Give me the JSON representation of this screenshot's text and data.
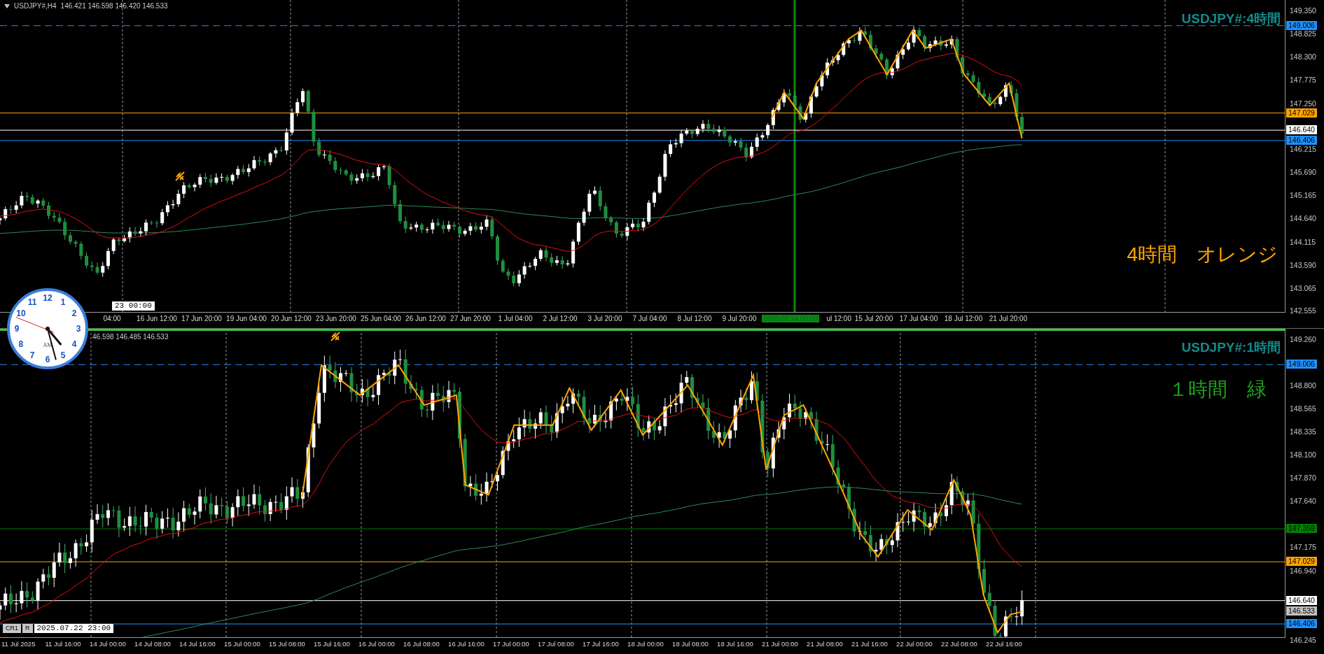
{
  "panes": [
    {
      "header": {
        "symbol": "USDJPY#,H4",
        "ohlc": "146.421 146.598 146.420 146.533"
      },
      "title": "USDJPY#:4時間",
      "note": "4時間　オレンジ",
      "price_ticks": [
        "149.350",
        "148.825",
        "148.300",
        "147.775",
        "147.250",
        "146.215",
        "145.690",
        "145.165",
        "144.640",
        "144.115",
        "143.590",
        "143.065",
        "142.555"
      ],
      "price_markers": [
        {
          "label": "149.006",
          "color": "#1e90ff",
          "kind": "dashed"
        },
        {
          "label": "147.029",
          "color": "#ffa500",
          "kind": "solid"
        },
        {
          "label": "146.640",
          "color": "#ffffff",
          "kind": "solid"
        },
        {
          "label": "146.406",
          "color": "#1e90ff",
          "kind": "solid"
        }
      ],
      "cursor_label": "23 00:00",
      "time_labels": [
        {
          "label": "04:00",
          "kind": "tick"
        },
        {
          "label": "16 Jun 12:00",
          "kind": "tick"
        },
        {
          "label": "17 Jun 20:00",
          "kind": "tick"
        },
        {
          "label": "19 Jun 04:00",
          "kind": "tick"
        },
        {
          "label": "20 Jun 12:00",
          "kind": "tick"
        },
        {
          "label": "23 Jun 20:00",
          "kind": "tick"
        },
        {
          "label": "25 Jun 04:00",
          "kind": "tick"
        },
        {
          "label": "26 Jun 12:00",
          "kind": "tick"
        },
        {
          "label": "27 Jun 20:00",
          "kind": "tick"
        },
        {
          "label": "1 Jul 04:00",
          "kind": "tick"
        },
        {
          "label": "2 Jul 12:00",
          "kind": "tick"
        },
        {
          "label": "3 Jul 20:00",
          "kind": "tick"
        },
        {
          "label": "7 Jul 04:00",
          "kind": "tick"
        },
        {
          "label": "8 Jul 12:00",
          "kind": "tick"
        },
        {
          "label": "9 Jul 20:00",
          "kind": "tick"
        },
        {
          "label": "2025.07.14 00:00",
          "kind": "cursor"
        },
        {
          "label": "ul 12:00",
          "kind": "tick"
        },
        {
          "label": "15 Jul 20:00",
          "kind": "tick"
        },
        {
          "label": "17 Jul 04:00",
          "kind": "tick"
        },
        {
          "label": "18 Jul 12:00",
          "kind": "tick"
        },
        {
          "label": "21 Jul 20:00",
          "kind": "tick"
        }
      ]
    },
    {
      "header": {
        "ohlc": "46.598 146.485 146.533"
      },
      "title": "USDJPY#:1時間",
      "note": "１時間　緑",
      "price_ticks": [
        "149.260",
        "148.800",
        "148.565",
        "148.335",
        "148.100",
        "147.870",
        "147.640",
        "147.175",
        "146.940",
        "146.245"
      ],
      "price_markers": [
        {
          "label": "149.006",
          "color": "#1e90ff",
          "kind": "dashed"
        },
        {
          "label": "147.359",
          "color": "#008000",
          "kind": "solid"
        },
        {
          "label": "147.029",
          "color": "#ffa500",
          "kind": "solid"
        },
        {
          "label": "146.640",
          "color": "#ffffff",
          "kind": "solid"
        },
        {
          "label": "146.533",
          "color": "#c0c0c0",
          "kind": "none"
        },
        {
          "label": "146.406",
          "color": "#1e90ff",
          "kind": "solid"
        }
      ],
      "status_tags": [
        "CR1",
        "R"
      ],
      "cursor_label": "2025.07.22 23:00",
      "time_labels": [
        {
          "label": "11 Jul 2025",
          "kind": "tick"
        },
        {
          "label": "11 Jul 16:00",
          "kind": "tick"
        },
        {
          "label": "14 Jul 00:00",
          "kind": "tick"
        },
        {
          "label": "14 Jul 08:00",
          "kind": "tick"
        },
        {
          "label": "14 Jul 16:00",
          "kind": "tick"
        },
        {
          "label": "15 Jul 00:00",
          "kind": "tick"
        },
        {
          "label": "15 Jul 08:00",
          "kind": "tick"
        },
        {
          "label": "15 Jul 16:00",
          "kind": "tick"
        },
        {
          "label": "16 Jul 00:00",
          "kind": "tick"
        },
        {
          "label": "16 Jul 08:00",
          "kind": "tick"
        },
        {
          "label": "16 Jul 16:00",
          "kind": "tick"
        },
        {
          "label": "17 Jul 00:00",
          "kind": "tick"
        },
        {
          "label": "17 Jul 08:00",
          "kind": "tick"
        },
        {
          "label": "17 Jul 16:00",
          "kind": "tick"
        },
        {
          "label": "18 Jul 00:00",
          "kind": "tick"
        },
        {
          "label": "18 Jul 08:00",
          "kind": "tick"
        },
        {
          "label": "18 Jul 16:00",
          "kind": "tick"
        },
        {
          "label": "21 Jul 00:00",
          "kind": "tick"
        },
        {
          "label": "21 Jul 08:00",
          "kind": "tick"
        },
        {
          "label": "21 Jul 16:00",
          "kind": "tick"
        },
        {
          "label": "22 Jul 00:00",
          "kind": "tick"
        },
        {
          "label": "22 Jul 08:00",
          "kind": "tick"
        },
        {
          "label": "22 Jul 16:00",
          "kind": "tick"
        }
      ]
    }
  ],
  "clock": {
    "numbers": [
      "12",
      "1",
      "2",
      "3",
      "4",
      "5",
      "6",
      "7",
      "8",
      "9",
      "10",
      "11"
    ],
    "meridiem": "AM"
  }
}
